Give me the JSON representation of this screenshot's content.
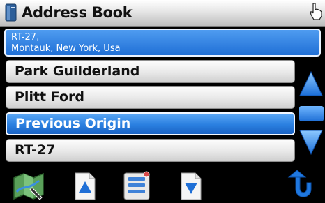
{
  "header": {
    "title": "Address Book"
  },
  "selected_address": {
    "line1": "RT-27,",
    "line2": "Montauk, New York, Usa"
  },
  "list": {
    "items": [
      {
        "label": "Park Guilderland",
        "selected": false
      },
      {
        "label": "Plitt Ford",
        "selected": false
      },
      {
        "label": "Previous Origin",
        "selected": true
      },
      {
        "label": "RT-27",
        "selected": false
      }
    ]
  },
  "scrollbar": {
    "up_icon": "triangle-up-icon",
    "down_icon": "triangle-down-icon"
  },
  "toolbar": {
    "buttons": [
      {
        "icon": "map-icon"
      },
      {
        "icon": "page-up-icon"
      },
      {
        "icon": "list-menu-icon"
      },
      {
        "icon": "page-down-icon"
      },
      {
        "icon": "back-arrow-icon"
      }
    ]
  },
  "colors": {
    "accent_blue": "#2a7fe0",
    "background": "#000000",
    "row_gray": "#e8e8e8"
  }
}
